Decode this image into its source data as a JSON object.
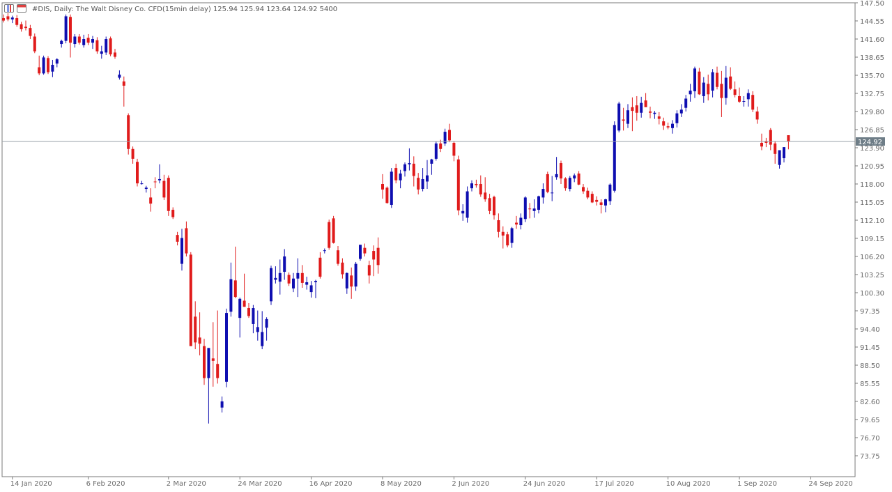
{
  "header": {
    "symbol_info": "#DIS, Daily:  The Walt Disney Co. CFD(15min delay)  125.94 125.94 123.64 124.92  5400"
  },
  "toolbar": {
    "icons": [
      "chart-window-icon",
      "trade-window-icon"
    ]
  },
  "colors": {
    "bull": "#0e0eb0",
    "bear": "#e01b1b",
    "axis": "#7a7a7a",
    "price_line": "#9aa1a8",
    "price_label_bg": "#6e7d87"
  },
  "chart_data": {
    "type": "candlestick",
    "title": "#DIS, Daily:  The Walt Disney Co. CFD(15min delay)",
    "last_bar": {
      "open": 125.94,
      "high": 125.94,
      "low": 123.64,
      "close": 124.92,
      "volume": 5400
    },
    "current_price_label": "124.92",
    "current_price": 124.92,
    "ylim": [
      71.5,
      147.6
    ],
    "y_ticks": [
      "147.50",
      "144.55",
      "141.60",
      "138.65",
      "135.70",
      "132.75",
      "129.80",
      "126.85",
      "123.90",
      "120.95",
      "118.00",
      "115.05",
      "112.10",
      "109.15",
      "106.20",
      "103.25",
      "100.30",
      "97.35",
      "94.40",
      "91.45",
      "88.50",
      "85.55",
      "82.60",
      "79.65",
      "76.70",
      "73.75"
    ],
    "x_ticks": [
      "14 Jan 2020",
      "6 Feb 2020",
      "2 Mar 2020",
      "24 Mar 2020",
      "16 Apr 2020",
      "8 May 2020",
      "2 Jun 2020",
      "24 Jun 2020",
      "17 Jul 2020",
      "10 Aug 2020",
      "1 Sep 2020",
      "24 Sep 2020"
    ],
    "x_tick_bar_index": [
      2,
      19,
      37,
      53,
      69,
      85,
      101,
      117,
      133,
      149,
      165,
      181
    ],
    "ohlc": [
      [
        145.0,
        145.6,
        144.3,
        144.6
      ],
      [
        145.3,
        145.8,
        144.5,
        144.8
      ],
      [
        144.8,
        145.4,
        144.2,
        145.1
      ],
      [
        145.0,
        145.5,
        143.6,
        143.9
      ],
      [
        144.0,
        144.4,
        142.8,
        143.2
      ],
      [
        143.6,
        144.6,
        143.0,
        143.4
      ],
      [
        143.4,
        143.9,
        141.6,
        142.1
      ],
      [
        142.0,
        142.5,
        139.3,
        139.6
      ],
      [
        137.0,
        138.9,
        135.7,
        136.0
      ],
      [
        136.0,
        138.9,
        135.8,
        138.6
      ],
      [
        138.5,
        138.8,
        135.9,
        136.2
      ],
      [
        136.3,
        138.2,
        135.4,
        137.4
      ],
      [
        137.6,
        138.5,
        137.0,
        138.3
      ],
      [
        140.8,
        141.5,
        140.2,
        141.3
      ],
      [
        141.3,
        145.6,
        140.9,
        145.3
      ],
      [
        145.2,
        145.6,
        138.6,
        141.0
      ],
      [
        140.8,
        142.4,
        140.2,
        142.0
      ],
      [
        142.0,
        142.4,
        140.7,
        141.0
      ],
      [
        140.6,
        142.3,
        140.2,
        141.6
      ],
      [
        141.8,
        142.4,
        140.6,
        141.0
      ],
      [
        141.0,
        142.1,
        140.0,
        141.6
      ],
      [
        141.4,
        141.9,
        139.2,
        139.6
      ],
      [
        139.2,
        140.5,
        138.4,
        139.6
      ],
      [
        139.4,
        142.0,
        139.0,
        141.6
      ],
      [
        141.7,
        142.0,
        138.8,
        139.1
      ],
      [
        139.4,
        140.0,
        138.4,
        138.7
      ],
      [
        135.3,
        136.5,
        135.0,
        135.8
      ],
      [
        134.7,
        135.5,
        130.6,
        134.0
      ],
      [
        129.2,
        129.5,
        122.8,
        123.7
      ],
      [
        123.7,
        124.1,
        121.3,
        122.1
      ],
      [
        121.6,
        122.1,
        117.6,
        118.1
      ],
      [
        118.0,
        118.5,
        117.9,
        118.1
      ],
      [
        117.2,
        117.7,
        116.6,
        117.4
      ],
      [
        115.8,
        117.3,
        113.5,
        114.8
      ],
      [
        118.4,
        119.1,
        117.3,
        118.3
      ],
      [
        118.6,
        121.2,
        118.1,
        118.8
      ],
      [
        118.5,
        119.5,
        115.4,
        115.8
      ],
      [
        119.0,
        119.4,
        112.8,
        113.6
      ],
      [
        113.8,
        114.2,
        112.3,
        112.6
      ],
      [
        109.7,
        110.2,
        108.0,
        108.6
      ],
      [
        105.0,
        110.7,
        103.9,
        109.2
      ],
      [
        110.8,
        111.9,
        106.2,
        106.7
      ],
      [
        106.5,
        106.9,
        98.7,
        91.6
      ],
      [
        96.4,
        98.9,
        91.1,
        92.2
      ],
      [
        93.0,
        97.1,
        90.1,
        92.0
      ],
      [
        91.6,
        92.8,
        85.3,
        86.4
      ],
      [
        86.4,
        91.3,
        79.0,
        91.3
      ],
      [
        89.6,
        95.5,
        85.0,
        89.2
      ],
      [
        88.7,
        97.4,
        85.5,
        86.4
      ],
      [
        81.6,
        83.4,
        80.8,
        82.6
      ],
      [
        85.8,
        97.7,
        84.9,
        97.0
      ],
      [
        97.2,
        105.2,
        96.4,
        102.5
      ],
      [
        102.3,
        107.8,
        99.4,
        99.6
      ],
      [
        96.2,
        99.5,
        93.0,
        99.3
      ],
      [
        99.0,
        103.4,
        98.0,
        98.0
      ],
      [
        97.8,
        98.6,
        96.2,
        96.5
      ],
      [
        95.2,
        98.3,
        93.7,
        97.8
      ],
      [
        93.9,
        97.4,
        92.5,
        94.7
      ],
      [
        91.6,
        97.3,
        91.1,
        93.9
      ],
      [
        94.6,
        96.3,
        92.5,
        96.0
      ],
      [
        98.9,
        104.7,
        98.3,
        104.3
      ],
      [
        102.4,
        104.6,
        101.8,
        102.7
      ],
      [
        102.1,
        105.7,
        100.0,
        103.5
      ],
      [
        103.7,
        107.4,
        102.4,
        106.2
      ],
      [
        103.2,
        103.6,
        101.4,
        101.8
      ],
      [
        101.0,
        103.5,
        100.4,
        102.6
      ],
      [
        102.6,
        105.9,
        99.6,
        103.5
      ],
      [
        103.5,
        104.8,
        101.1,
        101.9
      ],
      [
        101.6,
        102.9,
        100.8,
        102.0
      ],
      [
        100.4,
        102.2,
        99.5,
        101.5
      ],
      [
        102.0,
        102.4,
        99.4,
        102.2
      ],
      [
        106.0,
        106.9,
        102.6,
        102.9
      ],
      [
        107.2,
        107.5,
        106.7,
        107.2
      ],
      [
        111.8,
        112.2,
        107.3,
        107.6
      ],
      [
        112.4,
        112.8,
        108.3,
        108.4
      ],
      [
        107.2,
        107.9,
        104.7,
        105.0
      ],
      [
        105.2,
        105.9,
        102.6,
        103.3
      ],
      [
        101.0,
        103.6,
        100.1,
        103.5
      ],
      [
        103.1,
        104.4,
        99.3,
        101.3
      ],
      [
        101.3,
        105.3,
        100.6,
        105.0
      ],
      [
        105.8,
        108.1,
        105.5,
        108.1
      ],
      [
        107.6,
        108.3,
        106.2,
        106.7
      ],
      [
        104.8,
        105.5,
        101.8,
        103.1
      ],
      [
        107.1,
        108.0,
        103.0,
        105.7
      ],
      [
        107.6,
        109.3,
        103.4,
        104.8
      ],
      [
        118.0,
        119.6,
        115.6,
        117.1
      ],
      [
        117.4,
        117.6,
        114.8,
        114.9
      ],
      [
        114.6,
        120.6,
        114.1,
        120.0
      ],
      [
        120.6,
        121.3,
        118.1,
        118.6
      ],
      [
        118.6,
        120.3,
        117.3,
        119.7
      ],
      [
        120.1,
        121.5,
        119.2,
        121.2
      ],
      [
        121.2,
        123.8,
        120.2,
        121.4
      ],
      [
        121.3,
        122.5,
        117.6,
        119.3
      ],
      [
        119.0,
        119.8,
        116.3,
        117.1
      ],
      [
        117.2,
        120.6,
        116.8,
        118.8
      ],
      [
        118.4,
        121.9,
        117.2,
        119.4
      ],
      [
        121.3,
        122.1,
        119.5,
        122.0
      ],
      [
        122.1,
        124.9,
        121.8,
        124.6
      ],
      [
        124.6,
        125.2,
        123.2,
        123.7
      ],
      [
        124.6,
        127.0,
        124.2,
        126.5
      ],
      [
        126.8,
        127.8,
        124.8,
        125.1
      ],
      [
        124.7,
        125.0,
        121.7,
        122.6
      ],
      [
        122.0,
        122.6,
        112.9,
        113.7
      ],
      [
        113.2,
        114.7,
        112.0,
        113.6
      ],
      [
        112.5,
        117.6,
        111.7,
        116.8
      ],
      [
        117.3,
        118.6,
        116.8,
        118.1
      ],
      [
        118.0,
        118.7,
        117.4,
        117.8
      ],
      [
        118.0,
        119.4,
        115.9,
        116.3
      ],
      [
        116.6,
        119.1,
        115.1,
        115.5
      ],
      [
        115.7,
        116.4,
        113.1,
        113.6
      ],
      [
        115.9,
        116.1,
        112.2,
        112.9
      ],
      [
        112.1,
        113.2,
        109.3,
        110.2
      ],
      [
        110.2,
        111.1,
        107.5,
        109.6
      ],
      [
        109.8,
        110.2,
        107.7,
        108.0
      ],
      [
        108.4,
        111.0,
        107.6,
        110.8
      ],
      [
        111.7,
        112.8,
        110.7,
        111.4
      ],
      [
        111.3,
        113.2,
        110.6,
        112.5
      ],
      [
        112.3,
        116.0,
        111.8,
        115.8
      ],
      [
        114.0,
        114.9,
        112.4,
        113.9
      ],
      [
        113.6,
        115.5,
        112.5,
        114.0
      ],
      [
        113.8,
        116.1,
        113.2,
        116.0
      ],
      [
        115.8,
        118.1,
        114.8,
        117.2
      ],
      [
        119.6,
        120.0,
        116.5,
        116.7
      ],
      [
        116.5,
        119.3,
        115.2,
        116.6
      ],
      [
        119.1,
        122.4,
        118.7,
        119.6
      ],
      [
        121.4,
        121.8,
        118.0,
        118.9
      ],
      [
        118.9,
        119.1,
        116.9,
        117.3
      ],
      [
        117.2,
        119.3,
        116.8,
        119.0
      ],
      [
        118.9,
        119.7,
        118.3,
        119.4
      ],
      [
        119.7,
        120.1,
        117.8,
        117.9
      ],
      [
        117.5,
        118.0,
        116.4,
        116.8
      ],
      [
        116.9,
        117.4,
        115.5,
        115.8
      ],
      [
        116.4,
        116.8,
        114.9,
        115.0
      ],
      [
        115.4,
        116.0,
        114.5,
        115.1
      ],
      [
        115.0,
        115.5,
        113.2,
        114.6
      ],
      [
        114.5,
        115.6,
        113.4,
        115.5
      ],
      [
        115.2,
        118.1,
        114.6,
        117.9
      ],
      [
        116.9,
        128.2,
        116.6,
        127.6
      ],
      [
        126.7,
        131.4,
        126.4,
        131.1
      ],
      [
        128.5,
        130.4,
        126.7,
        128.3
      ],
      [
        127.8,
        131.0,
        127.1,
        130.0
      ],
      [
        130.5,
        132.1,
        126.6,
        129.9
      ],
      [
        130.8,
        132.3,
        128.3,
        129.6
      ],
      [
        129.6,
        132.2,
        128.8,
        131.2
      ],
      [
        131.6,
        132.8,
        130.6,
        130.5
      ],
      [
        129.8,
        130.6,
        128.7,
        129.6
      ],
      [
        129.4,
        129.9,
        128.6,
        129.6
      ],
      [
        129.0,
        129.7,
        127.7,
        128.6
      ],
      [
        128.2,
        128.8,
        126.8,
        127.5
      ],
      [
        127.4,
        128.0,
        126.9,
        127.2
      ],
      [
        127.1,
        128.4,
        126.2,
        127.8
      ],
      [
        127.9,
        130.0,
        127.2,
        129.5
      ],
      [
        129.5,
        131.0,
        128.9,
        130.1
      ],
      [
        130.4,
        132.5,
        129.8,
        131.9
      ],
      [
        132.6,
        134.3,
        131.4,
        133.2
      ],
      [
        133.1,
        137.1,
        132.0,
        136.8
      ],
      [
        136.3,
        136.9,
        132.5,
        132.6
      ],
      [
        132.3,
        135.4,
        131.2,
        134.5
      ],
      [
        134.3,
        135.8,
        131.6,
        132.6
      ],
      [
        133.2,
        136.7,
        132.1,
        136.2
      ],
      [
        136.1,
        137.1,
        133.4,
        133.8
      ],
      [
        134.3,
        136.4,
        128.9,
        132.0
      ],
      [
        132.0,
        137.2,
        130.9,
        135.3
      ],
      [
        135.5,
        137.0,
        133.3,
        133.5
      ],
      [
        133.4,
        134.7,
        132.1,
        132.5
      ],
      [
        132.3,
        133.7,
        131.2,
        131.4
      ],
      [
        131.5,
        132.3,
        130.6,
        131.5
      ],
      [
        131.8,
        133.4,
        130.6,
        132.8
      ],
      [
        132.5,
        133.1,
        129.7,
        130.1
      ],
      [
        129.8,
        130.6,
        127.8,
        128.5
      ],
      [
        124.7,
        126.2,
        123.5,
        124.1
      ],
      [
        125.0,
        125.5,
        124.0,
        124.7
      ],
      [
        126.8,
        127.1,
        123.5,
        124.4
      ],
      [
        124.6,
        125.0,
        121.3,
        122.9
      ],
      [
        121.1,
        122.8,
        120.5,
        123.5
      ],
      [
        122.2,
        124.0,
        121.5,
        124.0
      ],
      [
        125.94,
        125.94,
        123.64,
        124.92
      ]
    ]
  }
}
